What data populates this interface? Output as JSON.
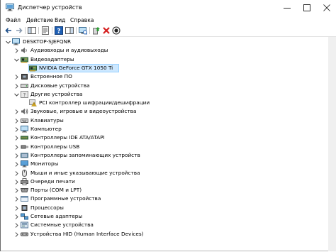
{
  "window": {
    "title": "Диспетчер устройств",
    "accent": "#0078d7"
  },
  "menu": [
    {
      "label": "Файл"
    },
    {
      "label": "Действие"
    },
    {
      "label": "Вид"
    },
    {
      "label": "Справка"
    }
  ],
  "toolbar": [
    {
      "icon": "back-arrow-icon"
    },
    {
      "icon": "forward-arrow-icon"
    },
    {
      "icon": "show-hide-console-tree-icon"
    },
    {
      "icon": "properties-icon"
    },
    {
      "icon": "help-icon"
    },
    {
      "icon": "action-pane-icon"
    },
    {
      "icon": "scan-hardware-changes-icon"
    },
    {
      "icon": "update-driver-icon"
    },
    {
      "icon": "uninstall-device-icon"
    },
    {
      "icon": "download-driver-icon"
    }
  ],
  "tree": {
    "root": {
      "label": "DESKTOP-SJEFQNR",
      "icon": "computer-icon"
    },
    "items": [
      {
        "label": "Аудиовходы и аудиовыходы",
        "icon": "audio-icon",
        "level": 1,
        "state": "collapsed"
      },
      {
        "label": "Видеоадаптеры",
        "icon": "display-adapter-icon",
        "level": 1,
        "state": "expanded"
      },
      {
        "label": "NVIDIA GeForce GTX 1050 Ti",
        "icon": "display-adapter-icon",
        "level": 2,
        "state": "leaf",
        "selected": true
      },
      {
        "label": "Встроенное ПО",
        "icon": "firmware-icon",
        "level": 1,
        "state": "collapsed"
      },
      {
        "label": "Дисковые устройства",
        "icon": "disk-icon",
        "level": 1,
        "state": "collapsed"
      },
      {
        "label": "Другие устройства",
        "icon": "unknown-device-icon",
        "level": 1,
        "state": "expanded"
      },
      {
        "label": "PCI контроллер шифрации/дешифрации",
        "icon": "warning-device-icon",
        "level": 2,
        "state": "leaf"
      },
      {
        "label": "Звуковые, игровые и видеоустройства",
        "icon": "sound-icon",
        "level": 1,
        "state": "collapsed"
      },
      {
        "label": "Клавиатуры",
        "icon": "keyboard-icon",
        "level": 1,
        "state": "collapsed"
      },
      {
        "label": "Компьютер",
        "icon": "computer-icon",
        "level": 1,
        "state": "collapsed"
      },
      {
        "label": "Контроллеры IDE ATA/ATAPI",
        "icon": "ide-controller-icon",
        "level": 1,
        "state": "collapsed"
      },
      {
        "label": "Контроллеры USB",
        "icon": "usb-icon",
        "level": 1,
        "state": "collapsed"
      },
      {
        "label": "Контроллеры запоминающих устройств",
        "icon": "storage-controller-icon",
        "level": 1,
        "state": "collapsed"
      },
      {
        "label": "Мониторы",
        "icon": "monitor-icon",
        "level": 1,
        "state": "collapsed"
      },
      {
        "label": "Мыши и иные указывающие устройства",
        "icon": "mouse-icon",
        "level": 1,
        "state": "collapsed"
      },
      {
        "label": "Очереди печати",
        "icon": "printer-icon",
        "level": 1,
        "state": "collapsed"
      },
      {
        "label": "Порты (COM и LPT)",
        "icon": "port-icon",
        "level": 1,
        "state": "collapsed"
      },
      {
        "label": "Программные устройства",
        "icon": "software-device-icon",
        "level": 1,
        "state": "collapsed"
      },
      {
        "label": "Процессоры",
        "icon": "processor-icon",
        "level": 1,
        "state": "collapsed"
      },
      {
        "label": "Сетевые адаптеры",
        "icon": "network-adapter-icon",
        "level": 1,
        "state": "collapsed"
      },
      {
        "label": "Системные устройства",
        "icon": "system-device-icon",
        "level": 1,
        "state": "collapsed"
      },
      {
        "label": "Устройства HID (Human Interface Devices)",
        "icon": "hid-icon",
        "level": 1,
        "state": "collapsed"
      }
    ]
  }
}
